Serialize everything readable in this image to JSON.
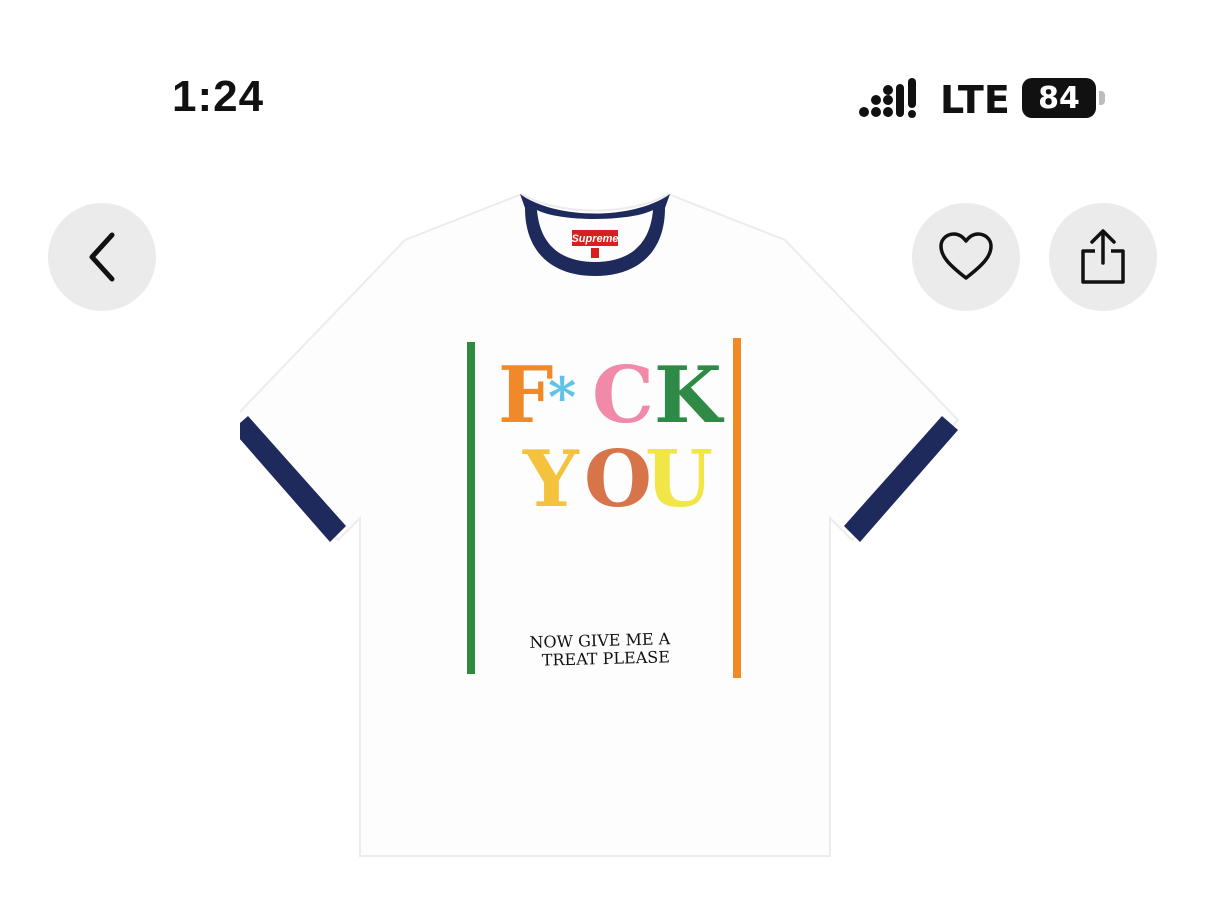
{
  "status_bar": {
    "time": "1:24",
    "network": "LTE",
    "battery": "84",
    "icons": [
      "signal-icon",
      "battery-icon"
    ]
  },
  "nav": {
    "icons": [
      "chevron-left-icon",
      "heart-icon",
      "share-icon"
    ]
  },
  "product_image": {
    "brand_label": "Supreme",
    "line1": [
      "F",
      "*",
      "C",
      "K"
    ],
    "line2": [
      "Y",
      "O",
      "U"
    ],
    "tagline_1": "NOW GIVE ME A",
    "tagline_2": "TREAT PLEASE",
    "colors": {
      "ringer": "#1f2a5c",
      "green_bar": "#2e8b3e",
      "orange_bar": "#f08a24",
      "letter_F": "#f0892a",
      "asterisk": "#5ec3e8",
      "letter_C": "#f08aa8",
      "letter_K": "#2f8a45",
      "letter_Y": "#f4c23c",
      "letter_O": "#d8744a",
      "letter_U": "#f1e548",
      "label_red": "#d81e1e"
    }
  }
}
